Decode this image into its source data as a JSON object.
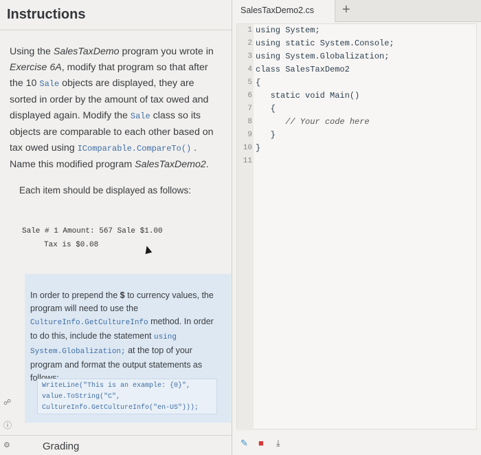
{
  "instructions": {
    "title": "Instructions",
    "intro": {
      "p1": "Using the ",
      "p1_em": "SalesTaxDemo",
      "p2": " program you wrote in ",
      "p2_em": "Exercise 6A",
      "p3": ", modify that program so that after the 10 ",
      "code1": "Sale",
      "p4": " objects are displayed, they are sorted in order by the amount of tax owed and displayed again. Modify the ",
      "code2": "Sale",
      "p5": " class so its objects are comparable to each other based on tax owed using ",
      "code3": "IComparable.CompareTo()",
      "p6": " . Name this modified program ",
      "p6_em": "SalesTaxDemo2",
      "p7": "."
    },
    "display_line": "Each item should be displayed as follows:",
    "sample_line1": "Sale # 1 Amount: 567 Sale $1.00",
    "sample_line2": "Tax is $0.08",
    "note": {
      "t1": "In order to prepend the ",
      "dollar": "$",
      "t2": " to currency values, the program will need to use the ",
      "code1": "CultureInfo.GetCultureInfo",
      "t3": " method. In order to do this, include the statement ",
      "code2": "using System.Globalization;",
      "t4": " at the top of your program and format the output statements as follows:",
      "code_line1": "WriteLine(\"This is an example: {0}\",",
      "code_line2": "value.ToString(\"C\",",
      "code_line3": "CultureInfo.GetCultureInfo(\"en-US\")));"
    },
    "grading": "Grading"
  },
  "editor": {
    "tab_label": "SalesTaxDemo2.cs",
    "add_tab": "+",
    "lines": [
      {
        "n": "1",
        "code": "using System;"
      },
      {
        "n": "2",
        "code": "using static System.Console;"
      },
      {
        "n": "3",
        "code": "using System.Globalization;"
      },
      {
        "n": "4",
        "code": "class SalesTaxDemo2"
      },
      {
        "n": "5",
        "code": "{"
      },
      {
        "n": "6",
        "code": "   static void Main()"
      },
      {
        "n": "7",
        "code": "   {"
      },
      {
        "n": "8",
        "code": "      // Your code here"
      },
      {
        "n": "9",
        "code": "   }"
      },
      {
        "n": "10",
        "code": "}"
      },
      {
        "n": "11",
        "code": ""
      }
    ]
  },
  "colors": {
    "code_blue": "#3e6ea6",
    "note_bg": "#dde8f3",
    "toolbar_red": "#d33a3a"
  },
  "icons": [
    "link-icon",
    "help-icon",
    "settings-icon",
    "pencil-icon",
    "stop-icon",
    "download-icon"
  ]
}
